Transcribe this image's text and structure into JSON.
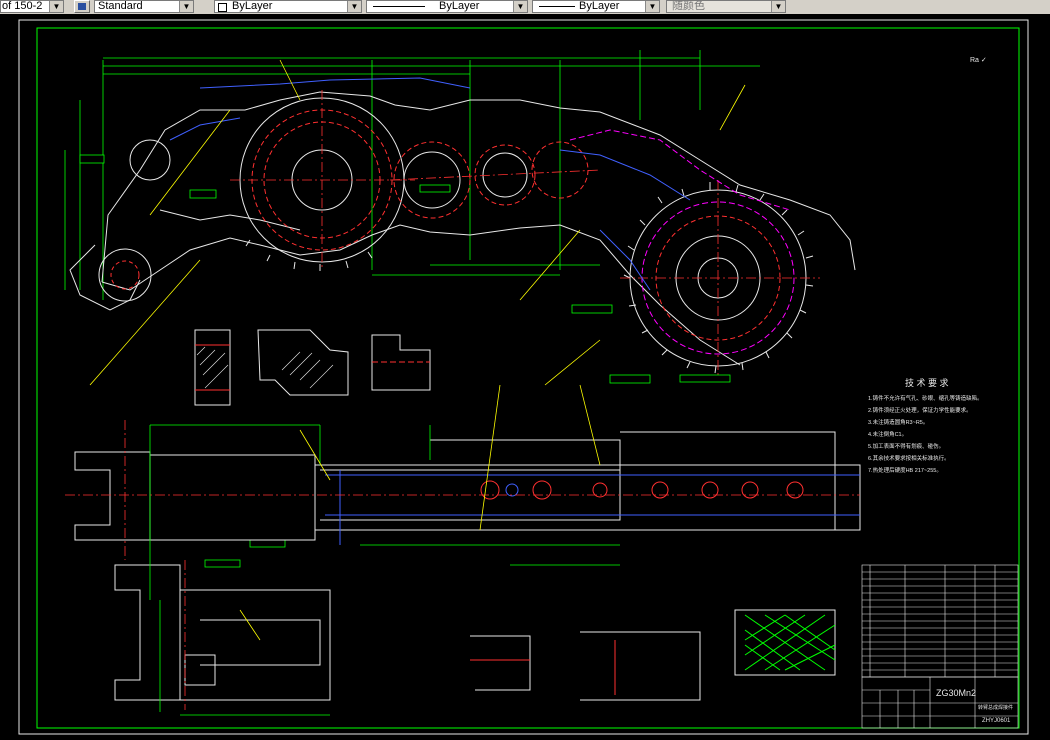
{
  "toolbar": {
    "scale_value": "of 150-2",
    "style_value": "Standard",
    "layer_value": "ByLayer",
    "linetype_value": "ByLayer",
    "lineweight_value": "ByLayer",
    "color_value": "随颜色"
  },
  "drawing": {
    "roughness_mark": "Ra ✓",
    "tech_title": "技 术 要 求",
    "tech_notes": [
      "1.铸件不允许有气孔、砂眼、缩孔等铸造缺陷。",
      "2.铸件须经正火处理，保证力学性能要求。",
      "3.未注铸造圆角R3~R5。",
      "4.未注倒角C1。",
      "5.加工表面不得有划痕、碰伤。",
      "6.其余技术要求按相关标准执行。",
      "7.热处理后硬度HB 217~255。"
    ],
    "material": "ZG30Mn2",
    "part_name": "转臂总成焊接件",
    "drawing_number": "ZHYJ0601"
  }
}
